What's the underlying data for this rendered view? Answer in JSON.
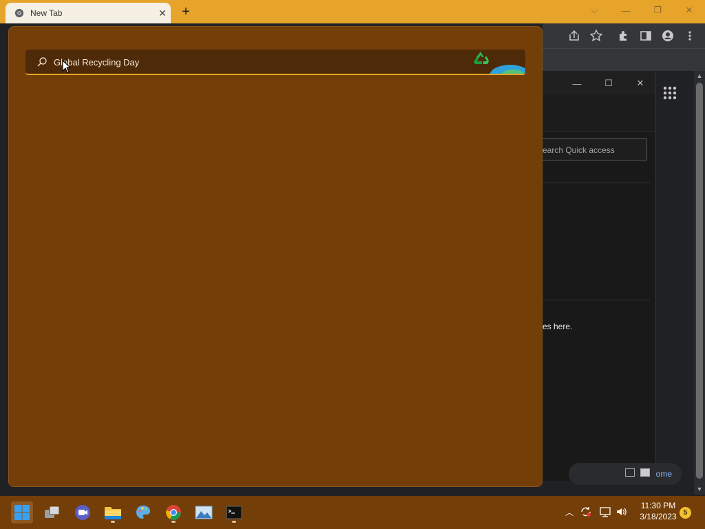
{
  "browser": {
    "tab_title": "New Tab",
    "tab_close_icon": "close-icon",
    "new_tab_icon": "plus-icon",
    "accent": "#e6a42a"
  },
  "explorer": {
    "search_placeholder": "earch Quick access",
    "empty_text": "es here.",
    "home_text": "ome"
  },
  "search_flyout": {
    "query": "Global Recycling Day",
    "background": "#733e07"
  },
  "taskbar": {
    "items": [
      "start",
      "task-view",
      "meet",
      "file-explorer",
      "paint",
      "chrome",
      "photos",
      "terminal"
    ],
    "time": "11:30 PM",
    "date": "3/18/2023",
    "notification_count": "5"
  }
}
